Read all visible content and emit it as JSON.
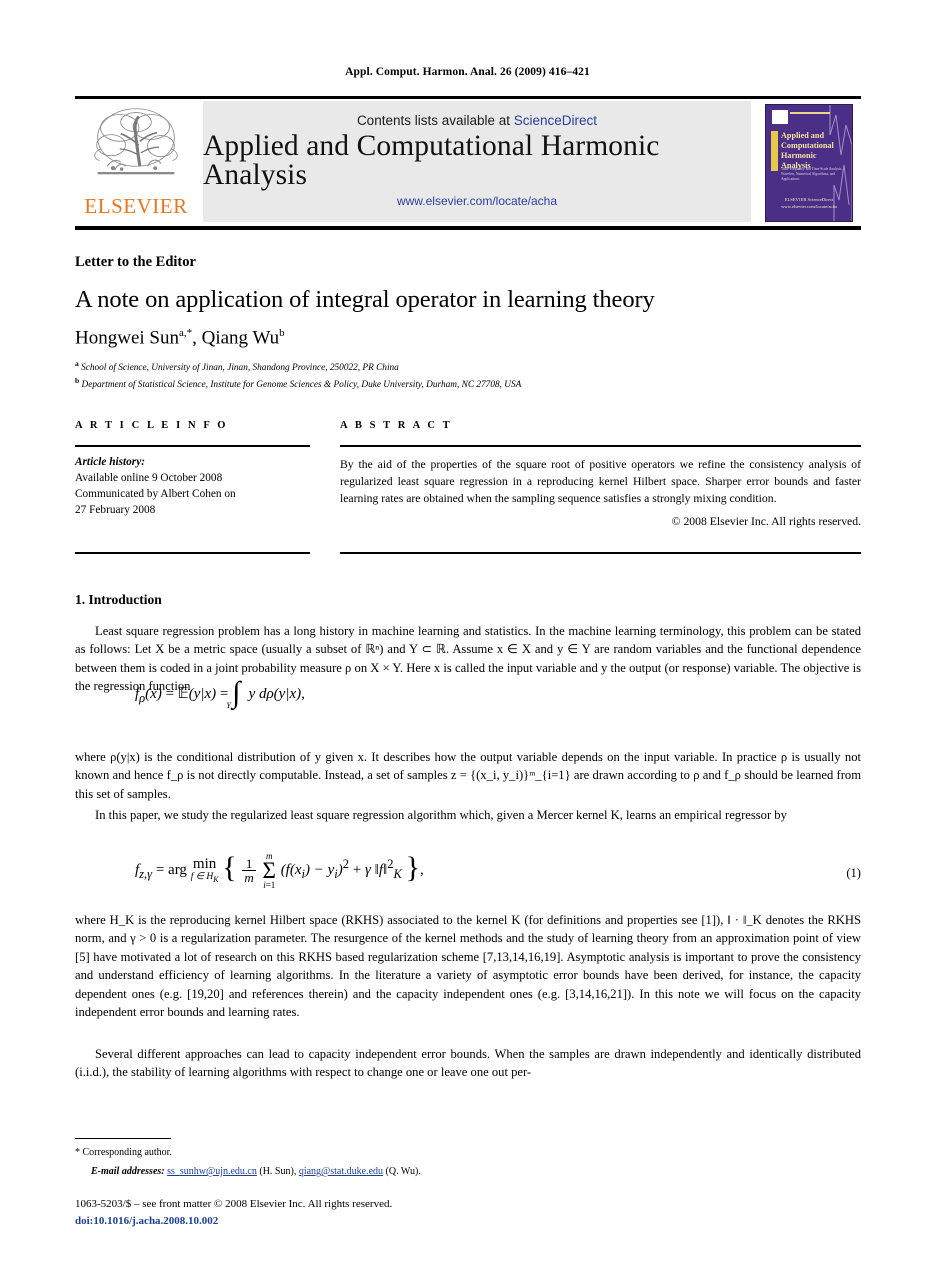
{
  "running_head": "Appl. Comput. Harmon. Anal. 26 (2009) 416–421",
  "masthead": {
    "publisher_wordmark": "ELSEVIER",
    "contents_prefix": "Contents lists available at ",
    "contents_link": "ScienceDirect",
    "journal_title": "Applied and Computational Harmonic Analysis",
    "journal_url": "www.elsevier.com/locate/acha",
    "cover": {
      "title": "Applied and Computational Harmonic Analysis",
      "subtitle": "Time-Frequency and Time-Scale Analysis, Wavelets, Numerical Algorithms, and Applications",
      "footer": "ELSEVIER\nScienceDirect\nwww.elsevier.com/locate/acha"
    },
    "accent_orange": "#e87722",
    "link_blue": "#2b3f9e",
    "cover_purple": "#4b2f86"
  },
  "article": {
    "kind": "Letter to the Editor",
    "title": "A note on application of integral operator in learning theory",
    "authors": "Hongwei Sun",
    "author1_sup": "a,*",
    "author2": ", Qiang Wu",
    "author2_sup": "b",
    "affiliation_a_sup": "a",
    "affiliation_a": "School of Science, University of Jinan, Jinan, Shandong Province, 250022, PR China",
    "affiliation_b_sup": "b",
    "affiliation_b": "Department of Statistical Science, Institute for Genome Sciences & Policy, Duke University, Durham, NC 27708, USA"
  },
  "info": {
    "heading": "A R T I C L E    I N F O",
    "history_label": "Article history:",
    "line1": "Available online 9 October 2008",
    "line2": "Communicated by Albert Cohen on",
    "line3": "27 February 2008"
  },
  "abstract": {
    "heading": "A B S T R A C T",
    "text": "By the aid of the properties of the square root of positive operators we refine the consistency analysis of regularized least square regression in a reproducing kernel Hilbert space. Sharper error bounds and faster learning rates are obtained when the sampling sequence satisfies a strongly mixing condition.",
    "copyright": "© 2008 Elsevier Inc. All rights reserved."
  },
  "body": {
    "section_heading": "1. Introduction",
    "para1": "Least square regression problem has a long history in machine learning and statistics. In the machine learning terminology, this problem can be stated as follows: Let X be a metric space (usually a subset of ℝⁿ) and Y ⊂ ℝ. Assume x ∈ X and y ∈ Y are random variables and the functional dependence between them is coded in a joint probability measure ρ on X × Y. Here x is called the input variable and y the output (or response) variable. The objective is the regression function",
    "equation_rho": "f_ρ(x) = 𝔼(y|x) = ∫_Y y dρ(y|x),",
    "para2": "where ρ(y|x) is the conditional distribution of y given x. It describes how the output variable depends on the input variable. In practice ρ is usually not known and hence f_ρ is not directly computable. Instead, a set of samples z = {(x_i, y_i)}ᵐ_{i=1} are drawn according to ρ and f_ρ should be learned from this set of samples.",
    "para3": "In this paper, we study the regularized least square regression algorithm which, given a Mercer kernel K, learns an empirical regressor by",
    "equation1": "f_{z,γ} = arg min_{f∈H_K} { (1/m) Σ_{i=1}^m (f(x_i) − y_i)² + γ‖f‖²_K },",
    "equation1_number": "(1)",
    "para4": "where H_K is the reproducing kernel Hilbert space (RKHS) associated to the kernel K (for definitions and properties see [1]), ‖ · ‖_K denotes the RKHS norm, and γ > 0 is a regularization parameter. The resurgence of the kernel methods and the study of learning theory from an approximation point of view [5] have motivated a lot of research on this RKHS based regularization scheme [7,13,14,16,19]. Asymptotic analysis is important to prove the consistency and understand efficiency of learning algorithms. In the literature a variety of asymptotic error bounds have been derived, for instance, the capacity dependent ones (e.g. [19,20] and references therein) and the capacity independent ones (e.g. [3,14,16,21]). In this note we will focus on the capacity independent error bounds and learning rates.",
    "para5": "Several different approaches can lead to capacity independent error bounds. When the samples are drawn independently and identically distributed (i.i.d.), the stability of learning algorithms with respect to change one or leave one out per-"
  },
  "footnotes": {
    "star": "*",
    "corresponding": "Corresponding author.",
    "email_label": "E-mail addresses:",
    "email1": "ss_sunhw@ujn.edu.cn",
    "email1_owner": " (H. Sun), ",
    "email2": "qiang@stat.duke.edu",
    "email2_owner": " (Q. Wu)."
  },
  "imprint": {
    "issn_line": "1063-5203/$ – see front matter © 2008 Elsevier Inc. All rights reserved.",
    "doi": "doi:10.1016/j.acha.2008.10.002"
  }
}
